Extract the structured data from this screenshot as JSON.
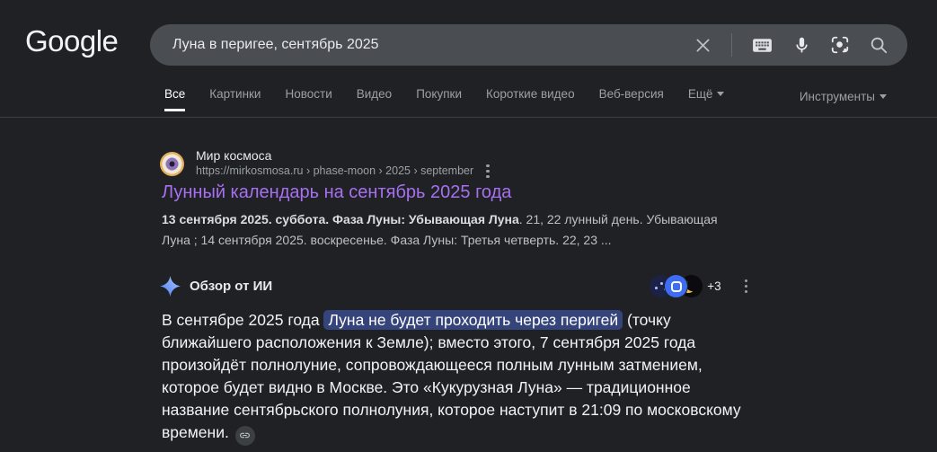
{
  "header": {
    "logo_text": "Google",
    "search": {
      "query": "Луна в перигее, сентябрь 2025"
    }
  },
  "tabs": {
    "items": [
      {
        "label": "Все",
        "active": true
      },
      {
        "label": "Картинки",
        "active": false
      },
      {
        "label": "Новости",
        "active": false
      },
      {
        "label": "Видео",
        "active": false
      },
      {
        "label": "Покупки",
        "active": false
      },
      {
        "label": "Короткие видео",
        "active": false
      },
      {
        "label": "Веб-версия",
        "active": false
      },
      {
        "label": "Ещё",
        "active": false
      }
    ],
    "tools_label": "Инструменты"
  },
  "result": {
    "site_name": "Мир космоса",
    "url_breadcrumb": "https://mirkosmosa.ru › phase-moon › 2025 › september",
    "title": "Лунный календарь на сентябрь 2025 года",
    "snippet_bold": "13 сентября 2025. суббота. Фаза Луны: Убывающая Луна",
    "snippet_rest": ". 21, 22 лунный день. Убывающая Луна ; 14 сентября 2025. воскресенье. Фаза Луны: Третья четверть. 22, 23 ..."
  },
  "ai_overview": {
    "label": "Обзор от ИИ",
    "more_sources_badge": "+3",
    "text_before": "В сентябре 2025 года ",
    "highlight": "Луна не будет проходить через перигей",
    "text_after": " (точку ближайшего расположения к Земле); вместо этого, 7 сентября 2025 года произойдёт полнолуние, сопровождающееся полным лунным затмением, которое будет видно в Москве. Это «Кукурузная Луна» — традиционное название сентябрьского полнолуния, которое наступит в 21:09 по московскому времени."
  },
  "icons": {
    "clear": "close-icon",
    "keyboard": "keyboard-icon",
    "microphone": "mic-icon",
    "lens": "lens-camera-icon",
    "search": "search-icon",
    "more_vertical": "three-dot-menu-icon",
    "sparkle": "ai-sparkle-icon",
    "link": "link-icon"
  },
  "colors": {
    "page_bg": "#202124",
    "searchbox_bg": "#4a4d51",
    "divider": "#3c4043",
    "tab_inactive": "#9aa0a6",
    "tab_active": "#ffffff",
    "visited_link": "#a770f0",
    "snippet_text": "#bdc1c6",
    "ai_text": "#f1f3f4",
    "highlight_bg": "#35447a",
    "sparkle_blue": "#8ab4f8",
    "source_blue": "#3d6cf5",
    "crescent_yellow": "#f0c14f"
  }
}
